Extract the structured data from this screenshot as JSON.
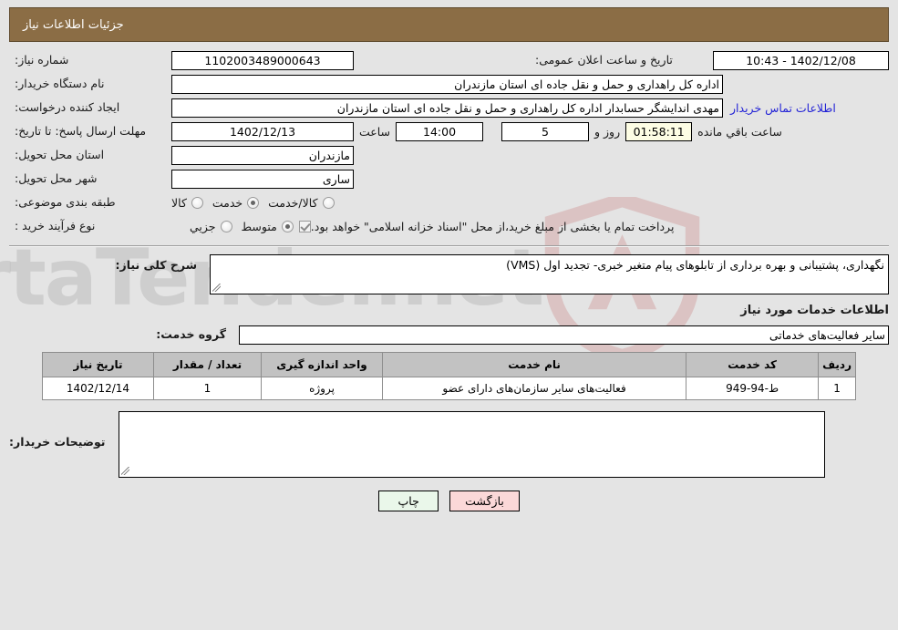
{
  "header": {
    "title": "جزئیات اطلاعات نیاز"
  },
  "top_form": {
    "need_number_label": "شماره نیاز:",
    "need_number_value": "1102003489000643",
    "announce_datetime_label": "تاریخ و ساعت اعلان عمومی:",
    "announce_datetime_value": "1402/12/08 - 10:43",
    "buyer_org_label": "نام دستگاه خریدار:",
    "buyer_org_value": "اداره کل راهداری و حمل و نقل جاده ای استان مازندران",
    "requester_label": "ایجاد کننده درخواست:",
    "requester_value": "مهدی اندایشگر حسابدار اداره کل راهداری و حمل و نقل جاده ای استان مازندران",
    "contact_link": "اطلاعات تماس خریدار",
    "deadline_label": "مهلت ارسال پاسخ: تا تاریخ:",
    "deadline_date": "1402/12/13",
    "hour_label": "ساعت",
    "deadline_time": "14:00",
    "remaining_days": "5",
    "days_and_label": "روز و",
    "remaining_time": "01:58:11",
    "remaining_suffix": "ساعت باقي مانده",
    "province_label": "استان محل تحویل:",
    "province_value": "مازندران",
    "city_label": "شهر محل تحویل:",
    "city_value": "ساری",
    "category_label": "طبقه بندی موضوعی:",
    "category_options": [
      {
        "label": "کالا",
        "selected": false
      },
      {
        "label": "خدمت",
        "selected": true
      },
      {
        "label": "کالا/خدمت",
        "selected": false
      }
    ],
    "process_label": "نوع فرآیند خرید :",
    "process_options": [
      {
        "label": "جزیي",
        "selected": false
      },
      {
        "label": "متوسط",
        "selected": true
      }
    ],
    "treasury_checked": true,
    "treasury_text": "پرداخت تمام یا بخشی از مبلغ خرید،از محل \"اسناد خزانه اسلامی\" خواهد بود."
  },
  "description": {
    "label": "شرح کلی نیاز:",
    "value": "نگهداری، پشتیبانی و بهره برداری از تابلوهای پیام متغیر خبری- تجدید اول (VMS)"
  },
  "services": {
    "section_title": "اطلاعات خدمات مورد نیاز",
    "group_label": "گروه خدمت:",
    "group_value": "سایر فعالیت‌های خدماتی",
    "table": {
      "headers": [
        "ردیف",
        "کد خدمت",
        "نام خدمت",
        "واحد اندازه گیری",
        "تعداد / مقدار",
        "تاریخ نیاز"
      ],
      "rows": [
        [
          "1",
          "ط-94-949",
          "فعالیت‌های سایر سازمان‌های دارای عضو",
          "پروژه",
          "1",
          "1402/12/14"
        ]
      ]
    }
  },
  "buyer_notes": {
    "label": "توضیحات خریدار:",
    "value": ""
  },
  "footer": {
    "print_label": "چاپ",
    "back_label": "بازگشت"
  },
  "watermark": {
    "text": "ArtaTender.net"
  },
  "colors": {
    "header_bg": "#8b6d45",
    "page_bg": "#e4e4e4",
    "link": "#2323d6",
    "table_header_bg": "#c2c2c2",
    "print_btn_bg": "#eaf7ea",
    "back_btn_bg": "#fbd8d8",
    "highlight_field_bg": "#fdfde4"
  }
}
